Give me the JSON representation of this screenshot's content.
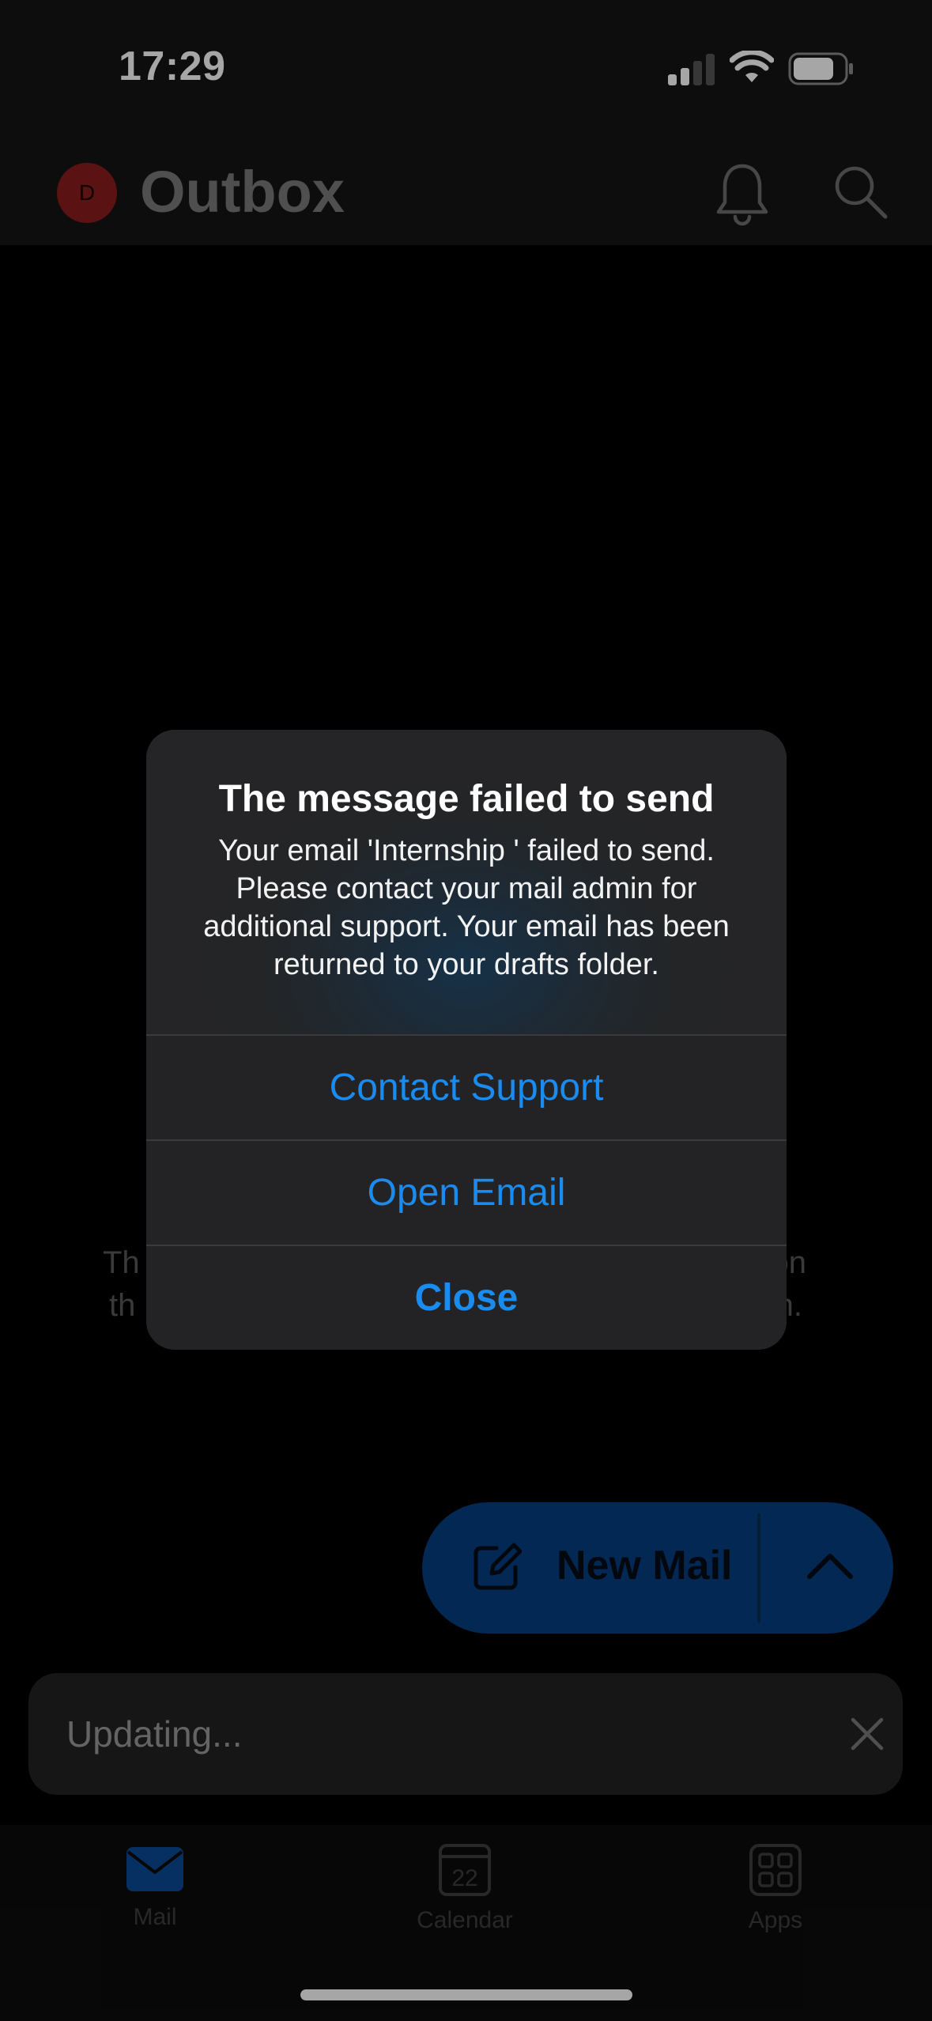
{
  "status_bar": {
    "time": "17:29"
  },
  "header": {
    "avatar_initial": "D",
    "title": "Outbox"
  },
  "empty_state": {
    "line1_left": "Th",
    "line1_right": "on",
    "line2_left": "th",
    "line2_right": "n."
  },
  "alert": {
    "title": "The message failed to send",
    "message": "Your email 'Internship ' failed to send. Please contact your mail admin for additional support. Your email has been returned to your drafts folder.",
    "buttons": [
      "Contact Support",
      "Open Email",
      "Close"
    ]
  },
  "fab": {
    "label": "New Mail"
  },
  "toast": {
    "text": "Updating..."
  },
  "tabbar": {
    "tabs": [
      {
        "label": "Mail",
        "icon": "mail-icon"
      },
      {
        "label": "Calendar",
        "icon": "calendar-icon",
        "day": "22"
      },
      {
        "label": "Apps",
        "icon": "apps-icon"
      }
    ]
  },
  "colors": {
    "accent": "#1a8cf0",
    "fab": "#063e80",
    "avatar": "#8c1c1c"
  }
}
